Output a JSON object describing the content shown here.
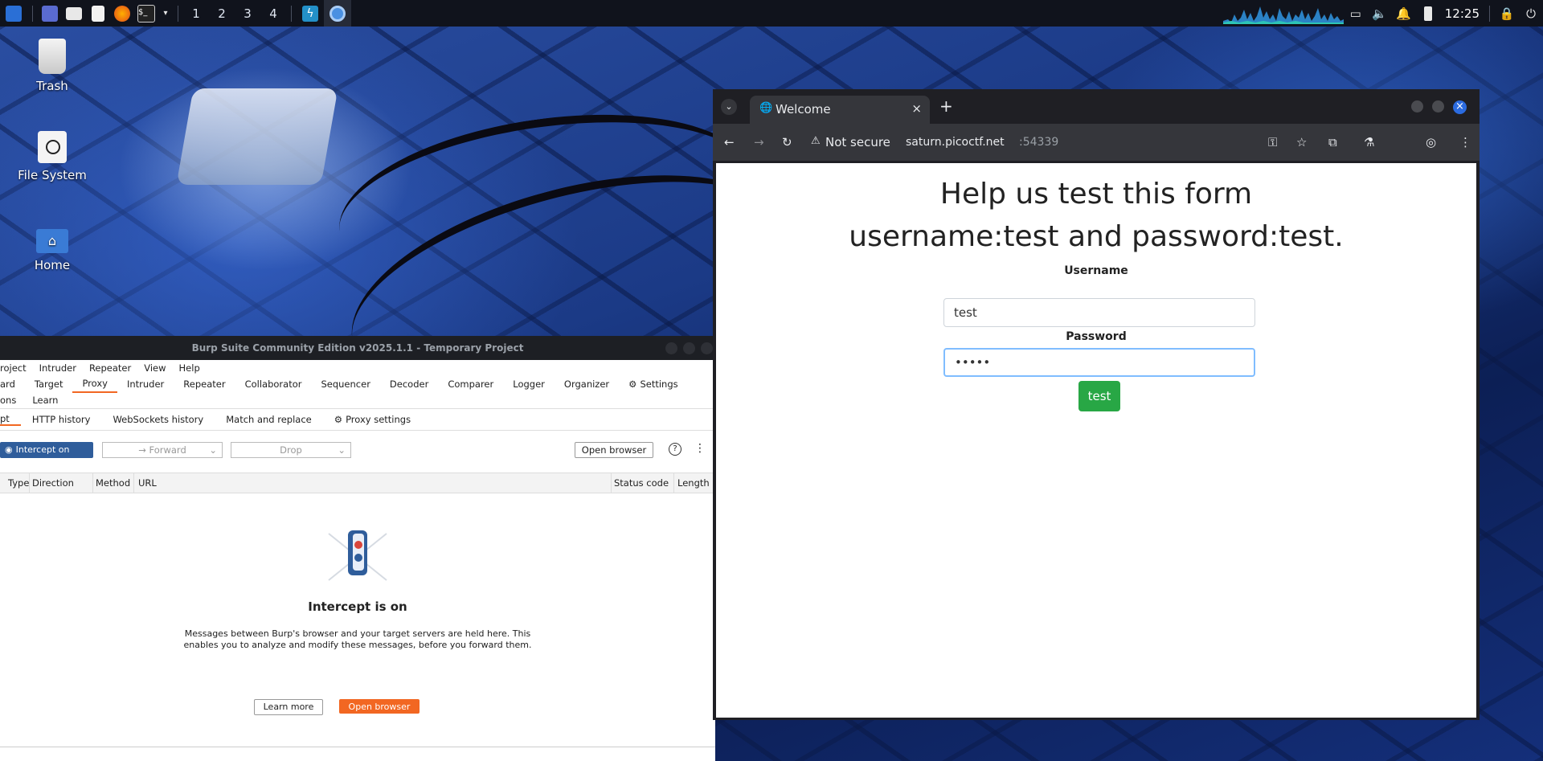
{
  "colors": {
    "panel_bg": "#10131c",
    "burp_accent": "#f26722",
    "burp_intercept_btn": "#2f5d9b",
    "chrome_frame": "#1f1f24",
    "chrome_tab": "#35363b",
    "submit_green": "#28a745",
    "input_focus": "#80bdff"
  },
  "panel": {
    "workspaces": [
      "1",
      "2",
      "3",
      "4"
    ],
    "clock": "12:25",
    "icons": [
      "kali-menu-icon",
      "show-desktop-icon",
      "file-manager-icon",
      "text-editor-icon",
      "firefox-icon",
      "terminal-icon",
      "terminal-dropdown-icon",
      "burp-icon",
      "chromium-icon",
      "cpu-graph-icon",
      "display-icon",
      "volume-icon",
      "notification-bell-icon",
      "battery-icon",
      "lock-icon",
      "logout-icon"
    ]
  },
  "desktop": {
    "icons": [
      {
        "label": "Trash",
        "icon": "trash-icon"
      },
      {
        "label": "File System",
        "icon": "drive-icon"
      },
      {
        "label": "Home",
        "icon": "home-folder-icon"
      }
    ]
  },
  "burp": {
    "title": "Burp Suite Community Edition v2025.1.1 - Temporary Project",
    "menu": [
      "roject",
      "Intruder",
      "Repeater",
      "View",
      "Help"
    ],
    "tabs": [
      "ard",
      "Target",
      "Proxy",
      "Intruder",
      "Repeater",
      "Collaborator",
      "Sequencer",
      "Decoder",
      "Comparer",
      "Logger",
      "Organizer",
      "Settings"
    ],
    "tabs_row2": [
      "ons",
      "Learn"
    ],
    "subtabs": [
      "pt",
      "HTTP history",
      "WebSockets history",
      "Match and replace",
      "Proxy settings"
    ],
    "toolbar": {
      "intercept": "Intercept on",
      "forward": "Forward",
      "drop": "Drop",
      "open_browser": "Open browser"
    },
    "table_headers": [
      "Type",
      "Direction",
      "Method",
      "URL",
      "Status code",
      "Length"
    ],
    "empty": {
      "title": "Intercept is on",
      "text": "Messages between Burp's browser and your target servers are held here. This enables you to analyze and modify these messages, before you forward them.",
      "learn_more": "Learn more",
      "open_browser": "Open browser"
    }
  },
  "chrome": {
    "tab_title": "Welcome",
    "not_secure": "Not secure",
    "url_host": "saturn.picoctf.net",
    "url_port": ":54339",
    "page": {
      "heading1": "Help us test this form",
      "heading2": "username:test and password:test.",
      "username_label": "Username",
      "username_value": "test",
      "password_label": "Password",
      "password_value": "•••••",
      "submit": "test"
    }
  }
}
